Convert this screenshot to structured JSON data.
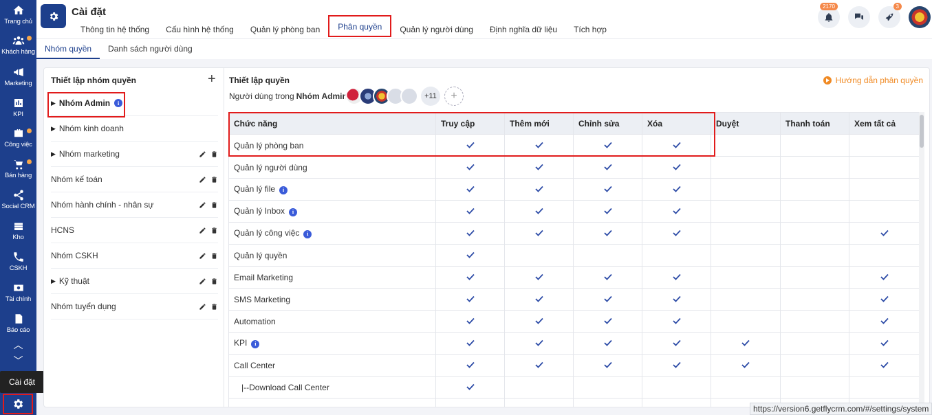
{
  "sidebar": {
    "items": [
      {
        "label": "Trang chủ",
        "icon": "home-icon",
        "dot": false
      },
      {
        "label": "Khách hàng",
        "icon": "customers-icon",
        "dot": true
      },
      {
        "label": "Marketing",
        "icon": "megaphone-icon",
        "dot": false
      },
      {
        "label": "KPI",
        "icon": "chart-icon",
        "dot": false
      },
      {
        "label": "Công việc",
        "icon": "briefcase-icon",
        "dot": true
      },
      {
        "label": "Bán hàng",
        "icon": "cart-icon",
        "dot": true
      },
      {
        "label": "Social CRM",
        "icon": "share-icon",
        "dot": false
      },
      {
        "label": "Kho",
        "icon": "warehouse-icon",
        "dot": false
      },
      {
        "label": "CSKH",
        "icon": "phone-icon",
        "dot": false
      },
      {
        "label": "Tài chính",
        "icon": "money-icon",
        "dot": false
      },
      {
        "label": "Báo cáo",
        "icon": "report-icon",
        "dot": false
      }
    ],
    "tooltip": "Cài đặt",
    "settings_icon": "gear-icon"
  },
  "header": {
    "title": "Cài đặt",
    "tabs": [
      {
        "label": "Thông tin hệ thống"
      },
      {
        "label": "Cấu hình hệ thống"
      },
      {
        "label": "Quản lý phòng ban"
      },
      {
        "label": "Phân quyền",
        "active": true
      },
      {
        "label": "Quản lý người dùng"
      },
      {
        "label": "Định nghĩa dữ liệu"
      },
      {
        "label": "Tích hợp"
      }
    ],
    "notifications_count": "2170",
    "rocket_count": "3"
  },
  "subtabs": [
    {
      "label": "Nhóm quyền",
      "active": true
    },
    {
      "label": "Danh sách người dùng"
    }
  ],
  "groups": {
    "title": "Thiết lập nhóm quyền",
    "items": [
      {
        "label": "Nhóm Admin",
        "arrow": true,
        "bold": true,
        "info": true,
        "editable": false
      },
      {
        "label": "Nhóm kinh doanh",
        "arrow": true,
        "editable": false
      },
      {
        "label": "Nhóm marketing",
        "arrow": true,
        "editable": true
      },
      {
        "label": "Nhóm kế toán",
        "arrow": false,
        "editable": true
      },
      {
        "label": "Nhóm hành chính - nhân sự",
        "arrow": false,
        "editable": true
      },
      {
        "label": "HCNS",
        "arrow": false,
        "editable": true
      },
      {
        "label": "Nhóm CSKH",
        "arrow": false,
        "editable": true
      },
      {
        "label": "Kỹ thuật",
        "arrow": true,
        "editable": true
      },
      {
        "label": "Nhóm tuyển dụng",
        "arrow": false,
        "editable": true
      }
    ]
  },
  "permissions": {
    "title": "Thiết lập quyền",
    "guide": "Hướng dẫn phân quyền",
    "users_prefix": "Người dùng trong",
    "users_group": "Nhóm Admin:",
    "more_users": "+11",
    "columns": [
      "Chức năng",
      "Truy cập",
      "Thêm mới",
      "Chỉnh sửa",
      "Xóa",
      "Duyệt",
      "Thanh toán",
      "Xem tất cả"
    ],
    "rows": [
      {
        "name": "Quản lý phòng ban",
        "info": false,
        "checks": [
          1,
          1,
          1,
          1,
          0,
          0,
          0
        ]
      },
      {
        "name": "Quản lý người dùng",
        "info": false,
        "checks": [
          1,
          1,
          1,
          1,
          0,
          0,
          0
        ]
      },
      {
        "name": "Quản lý file",
        "info": true,
        "checks": [
          1,
          1,
          1,
          1,
          0,
          0,
          0
        ]
      },
      {
        "name": "Quản lý Inbox",
        "info": true,
        "checks": [
          1,
          1,
          1,
          1,
          0,
          0,
          0
        ]
      },
      {
        "name": "Quản lý công việc",
        "info": true,
        "checks": [
          1,
          1,
          1,
          1,
          0,
          0,
          1
        ]
      },
      {
        "name": "Quản lý quyền",
        "info": false,
        "checks": [
          1,
          0,
          0,
          0,
          0,
          0,
          0
        ]
      },
      {
        "name": "Email Marketing",
        "info": false,
        "checks": [
          1,
          1,
          1,
          1,
          0,
          0,
          1
        ]
      },
      {
        "name": "SMS Marketing",
        "info": false,
        "checks": [
          1,
          1,
          1,
          1,
          0,
          0,
          1
        ]
      },
      {
        "name": "Automation",
        "info": false,
        "checks": [
          1,
          1,
          1,
          1,
          0,
          0,
          1
        ]
      },
      {
        "name": "KPI",
        "info": true,
        "checks": [
          1,
          1,
          1,
          1,
          1,
          0,
          1
        ]
      },
      {
        "name": "Call Center",
        "info": false,
        "checks": [
          1,
          1,
          1,
          1,
          1,
          0,
          1
        ]
      },
      {
        "name": "|--Download Call Center",
        "info": false,
        "indent": true,
        "checks": [
          1,
          0,
          0,
          0,
          0,
          0,
          0
        ]
      },
      {
        "name": "",
        "info": false,
        "checks": [
          0,
          0,
          0,
          0,
          0,
          0,
          0
        ]
      }
    ]
  },
  "status_url": "https://version6.getflycrm.com/#/settings/system"
}
